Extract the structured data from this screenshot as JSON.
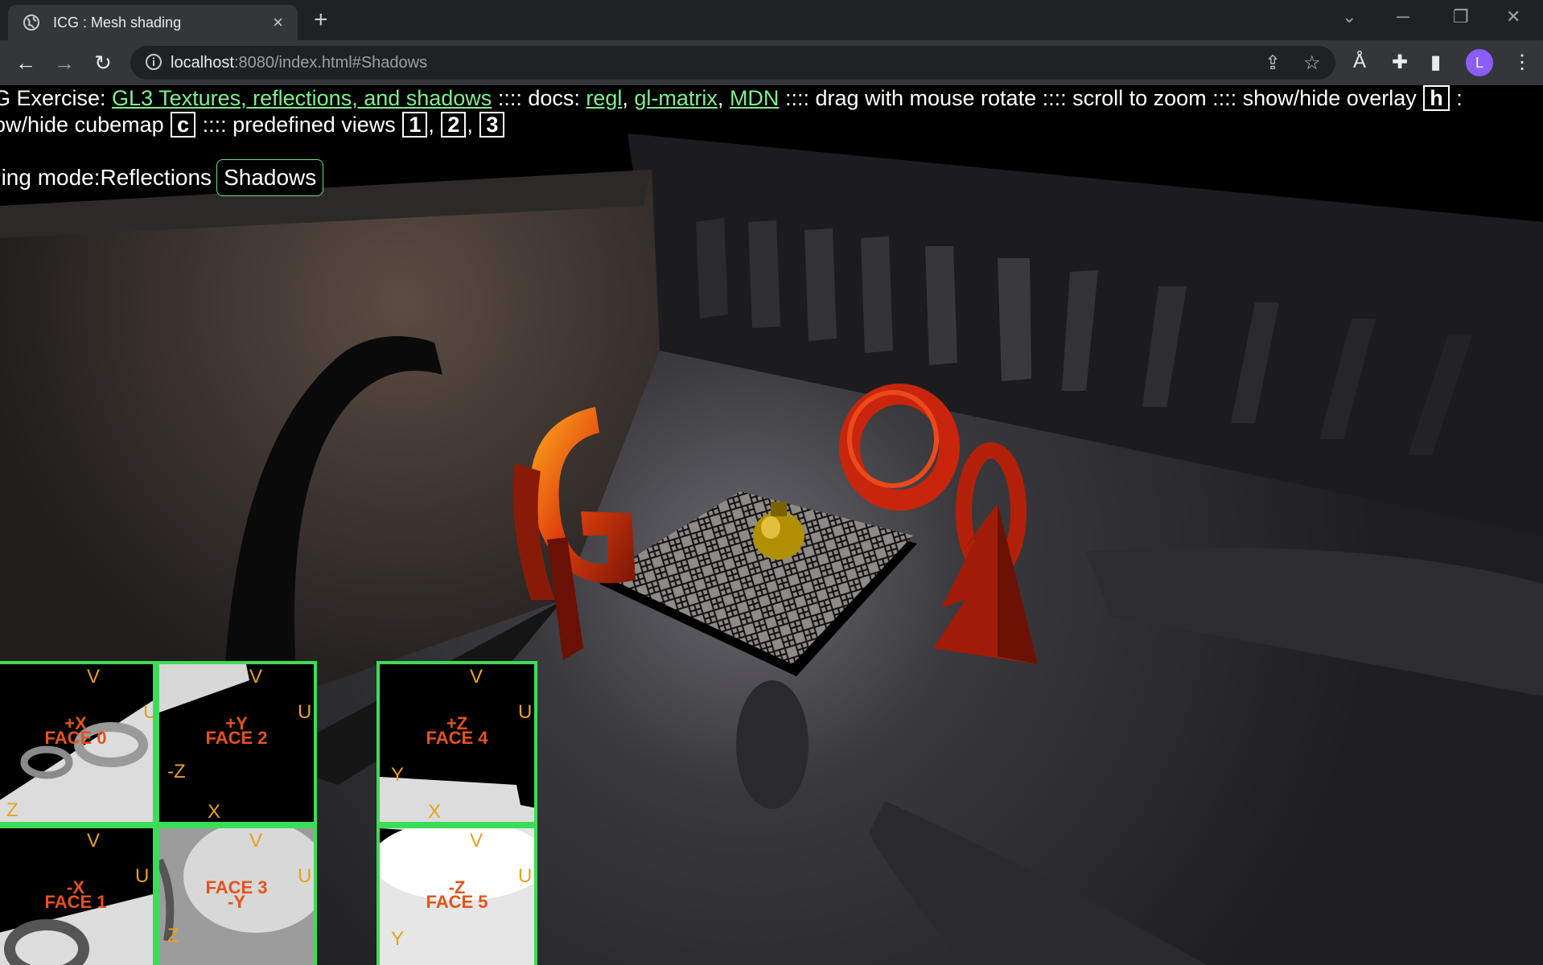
{
  "browser": {
    "tab_title": "ICG : Mesh shading",
    "tab_close": "×",
    "new_tab": "+",
    "url_host": "localhost",
    "url_rest": ":8080/index.html#Shadows",
    "avatar_letter": "L"
  },
  "overlay": {
    "line1_prefix": "G Exercise: ",
    "exercise_link": "GL3 Textures, reflections, and shadows",
    "docs_sep": " :::: docs: ",
    "doc_links": [
      "regl",
      "gl-matrix",
      "MDN"
    ],
    "drag_text": " :::: drag with mouse rotate :::: scroll to zoom :::: show/hide overlay ",
    "key_h": "h",
    "line1_end": " :",
    "line2_prefix": "ow/hide cubemap ",
    "key_c": "c",
    "views_text": " :::: predefined views ",
    "view_keys": [
      "1",
      "2",
      "3"
    ]
  },
  "modes": {
    "prefix": "ding mode: ",
    "reflections": "Reflections",
    "shadows": "Shadows"
  },
  "cubemap": {
    "faces": [
      {
        "line1": "+X",
        "line2": "FACE 0",
        "u": "U",
        "v": "V",
        "b1": "",
        "b2": "Z"
      },
      {
        "line1": "+Y",
        "line2": "FACE 2",
        "u": "U",
        "v": "V",
        "b1": "-Z",
        "b2": "X"
      },
      {
        "line1": "+Z",
        "line2": "FACE 4",
        "u": "U",
        "v": "V",
        "b1": "Y",
        "b2": "X"
      },
      {
        "line1": "-X",
        "line2": "FACE 1",
        "u": "U",
        "v": "V",
        "b1": "",
        "b2": ""
      },
      {
        "line1": "FACE 3",
        "line2": "-Y",
        "u": "U",
        "v": "V",
        "b1": "Z",
        "b2": ""
      },
      {
        "line1": "-Z",
        "line2": "FACE 5",
        "u": "U",
        "v": "V",
        "b1": "Y",
        "b2": ""
      }
    ]
  },
  "colors": {
    "link": "#7ef08e",
    "cubemap_border": "#3ddc58",
    "face_label": "#e5531b",
    "axis_label": "#e9a21a",
    "object_red": "#c8250c"
  },
  "icons": [
    "globe-icon",
    "close-icon",
    "plus-icon",
    "back-arrow-icon",
    "forward-arrow-icon",
    "reload-icon",
    "info-icon",
    "share-icon",
    "star-icon",
    "read-aloud-icon",
    "extensions-icon",
    "side-panel-icon",
    "menu-icon"
  ]
}
